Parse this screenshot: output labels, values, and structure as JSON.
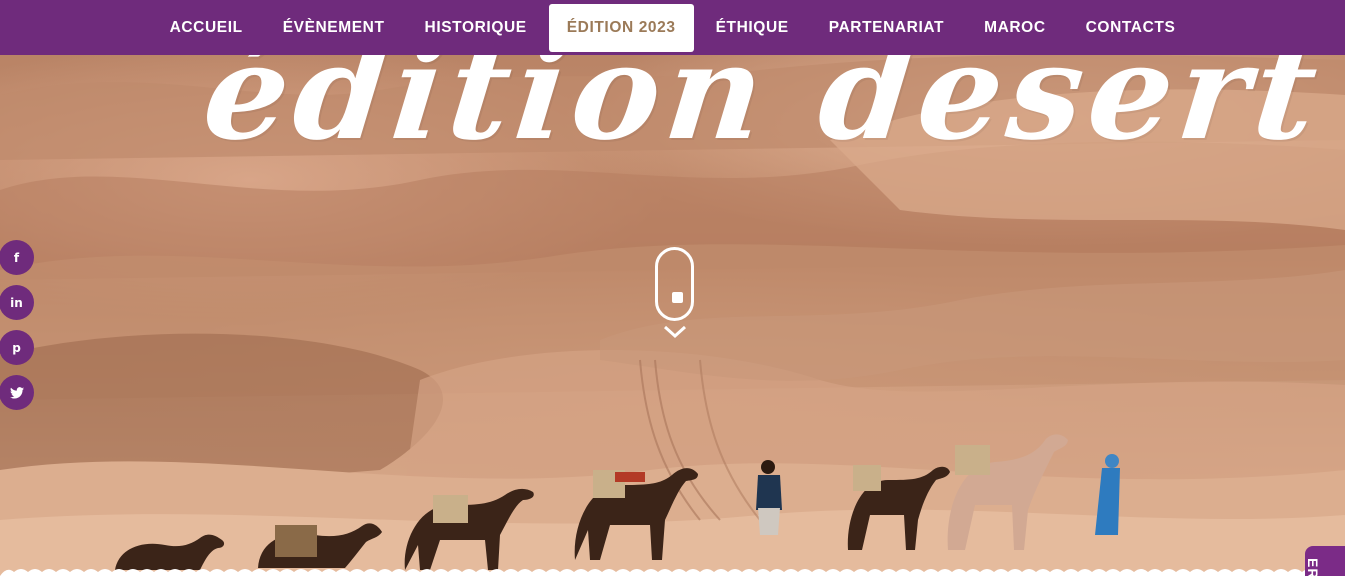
{
  "nav": {
    "items": [
      {
        "label": "ACCUEIL",
        "active": false
      },
      {
        "label": "ÉVÈNEMENT",
        "active": false
      },
      {
        "label": "HISTORIQUE",
        "active": false
      },
      {
        "label": "ÉDITION 2023",
        "active": true
      },
      {
        "label": "ÉTHIQUE",
        "active": false
      },
      {
        "label": "PARTENARIAT",
        "active": false
      },
      {
        "label": "MAROC",
        "active": false
      },
      {
        "label": "CONTACTS",
        "active": false
      }
    ],
    "bg_color": "#6f2b7c",
    "active_text_color": "#9b7a58"
  },
  "hero": {
    "title": "édition desert"
  },
  "social": [
    {
      "icon": "facebook-icon",
      "glyph": "f"
    },
    {
      "icon": "linkedin-icon",
      "glyph": "in"
    },
    {
      "icon": "pinterest-icon",
      "glyph": "p"
    },
    {
      "icon": "twitter-icon",
      "glyph": "t"
    }
  ],
  "corner_tab": {
    "label": "ER"
  }
}
